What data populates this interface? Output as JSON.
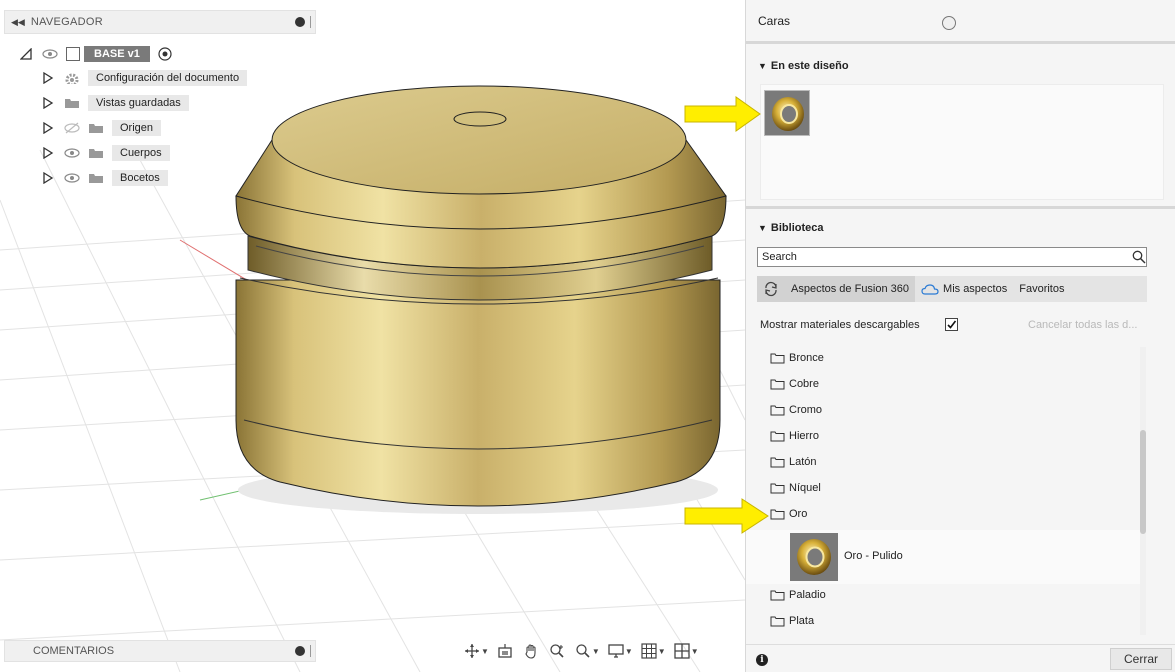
{
  "navigator": {
    "title": "NAVEGADOR",
    "root_label": "BASE v1",
    "items": [
      {
        "label": "Configuración del documento",
        "icon": "gear-icon"
      },
      {
        "label": "Vistas guardadas",
        "icon": "folder-icon"
      },
      {
        "label": "Origen",
        "icon": "folder-icon",
        "hidden": true
      },
      {
        "label": "Cuerpos",
        "icon": "folder-icon"
      },
      {
        "label": "Bocetos",
        "icon": "folder-icon"
      }
    ]
  },
  "comments": {
    "label": "COMENTARIOS"
  },
  "panel": {
    "caras_label": "Caras",
    "design_section": "En este diseño",
    "library_section": "Biblioteca",
    "search_placeholder": "Search",
    "tabs": [
      "Aspectos de Fusion 360",
      "Mis aspectos",
      "Favoritos"
    ],
    "show_downloadable": "Mostrar materiales descargables",
    "cancel_all": "Cancelar todas las d...",
    "library_items": [
      "Bronce",
      "Cobre",
      "Cromo",
      "Hierro",
      "Latón",
      "Níquel",
      "Oro",
      "Paladio",
      "Plata"
    ],
    "oro_pulido": "Oro - Pulido",
    "close_label": "Cerrar"
  },
  "colors": {
    "gold": "#c8b060",
    "arrow": "#ffee00",
    "panel_bg": "#f5f5f5"
  }
}
